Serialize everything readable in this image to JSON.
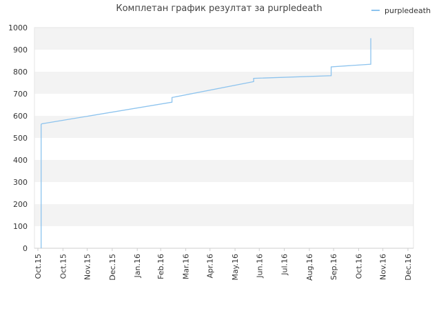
{
  "chart_data": {
    "type": "line",
    "title": "Комплетан график резултат за purpledeath",
    "legend": {
      "position": "top-right"
    },
    "ylim": [
      0,
      1000
    ],
    "yticks": [
      0,
      100,
      200,
      300,
      400,
      500,
      600,
      700,
      800,
      900,
      1000
    ],
    "xlim": [
      "2015-10-01",
      "2016-12-01"
    ],
    "xticks": [
      {
        "label": "Oct.15",
        "date": "2015-10-01"
      },
      {
        "label": "Oct.15",
        "date": "2015-11-01"
      },
      {
        "label": "Nov.15",
        "date": "2015-12-01"
      },
      {
        "label": "Dec.15",
        "date": "2016-01-01"
      },
      {
        "label": "Jan.16",
        "date": "2016-02-01"
      },
      {
        "label": "Feb.16",
        "date": "2016-03-01"
      },
      {
        "label": "Mar.16",
        "date": "2016-04-01"
      },
      {
        "label": "Apr.16",
        "date": "2016-05-01"
      },
      {
        "label": "May.16",
        "date": "2016-06-01"
      },
      {
        "label": "Jun.16",
        "date": "2016-07-01"
      },
      {
        "label": "Jul.16",
        "date": "2016-08-01"
      },
      {
        "label": "Aug.16",
        "date": "2016-09-01"
      },
      {
        "label": "Sep.16",
        "date": "2016-10-01"
      },
      {
        "label": "Oct.16",
        "date": "2016-11-01"
      },
      {
        "label": "Nov.16",
        "date": "2016-12-01"
      },
      {
        "label": "Dec.16",
        "date": "2017-01-01"
      }
    ],
    "grid": {
      "horizontal_bands": true,
      "colors": [
        "#f3f3f3",
        "#ffffff"
      ]
    },
    "series": [
      {
        "name": "purpledeath",
        "color": "#8cc3ee",
        "points": [
          {
            "x": "2015-10-05",
            "y": 0
          },
          {
            "x": "2015-10-05",
            "y": 562
          },
          {
            "x": "2015-10-06",
            "y": 564
          },
          {
            "x": "2016-03-15",
            "y": 662
          },
          {
            "x": "2016-03-15",
            "y": 683
          },
          {
            "x": "2016-06-24",
            "y": 755
          },
          {
            "x": "2016-06-24",
            "y": 770
          },
          {
            "x": "2016-09-28",
            "y": 782
          },
          {
            "x": "2016-09-28",
            "y": 822
          },
          {
            "x": "2016-11-16",
            "y": 834
          },
          {
            "x": "2016-11-16",
            "y": 952
          }
        ]
      }
    ]
  }
}
